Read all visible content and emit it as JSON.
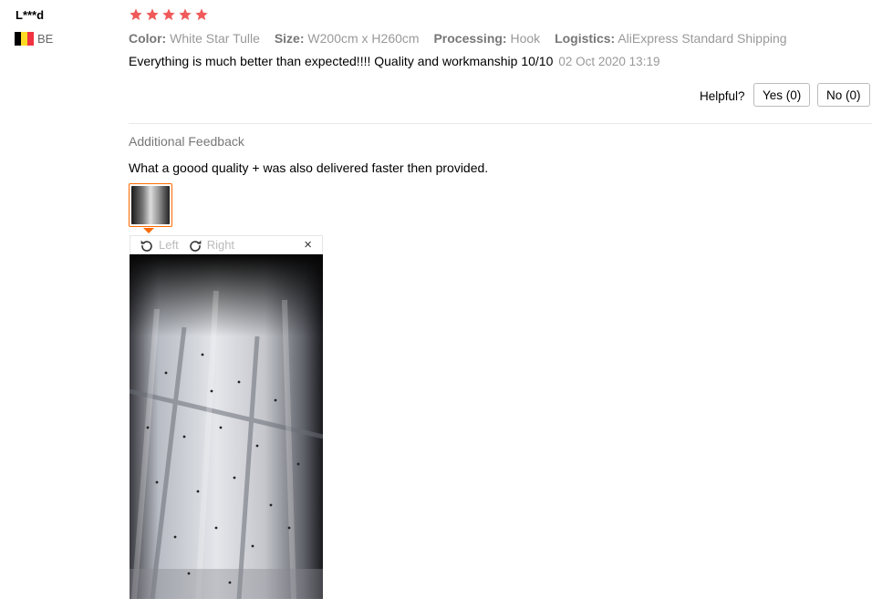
{
  "reviewer": {
    "name": "L***d",
    "country_code": "BE",
    "flag_colors": [
      "#000000",
      "#FDDA24",
      "#EF3340"
    ]
  },
  "rating": {
    "stars": 5,
    "max": 5,
    "star_color": "#F05A5A"
  },
  "attributes": [
    {
      "key": "Color:",
      "value": "White Star Tulle"
    },
    {
      "key": "Size:",
      "value": "W200cm x H260cm"
    },
    {
      "key": "Processing:",
      "value": "Hook"
    },
    {
      "key": "Logistics:",
      "value": "AliExpress Standard Shipping"
    }
  ],
  "review": {
    "text": "Everything is much better than expected!!!! Quality and workmanship 10/10",
    "date": "02 Oct 2020 13:19"
  },
  "helpful": {
    "label": "Helpful?",
    "yes": "Yes (0)",
    "no": "No (0)"
  },
  "additional": {
    "title": "Additional Feedback",
    "text": "What a goood quality + was also delivered faster then provided."
  },
  "viewer": {
    "left_label": "Left",
    "right_label": "Right",
    "close_glyph": "×",
    "accent": "#FF6A00"
  }
}
